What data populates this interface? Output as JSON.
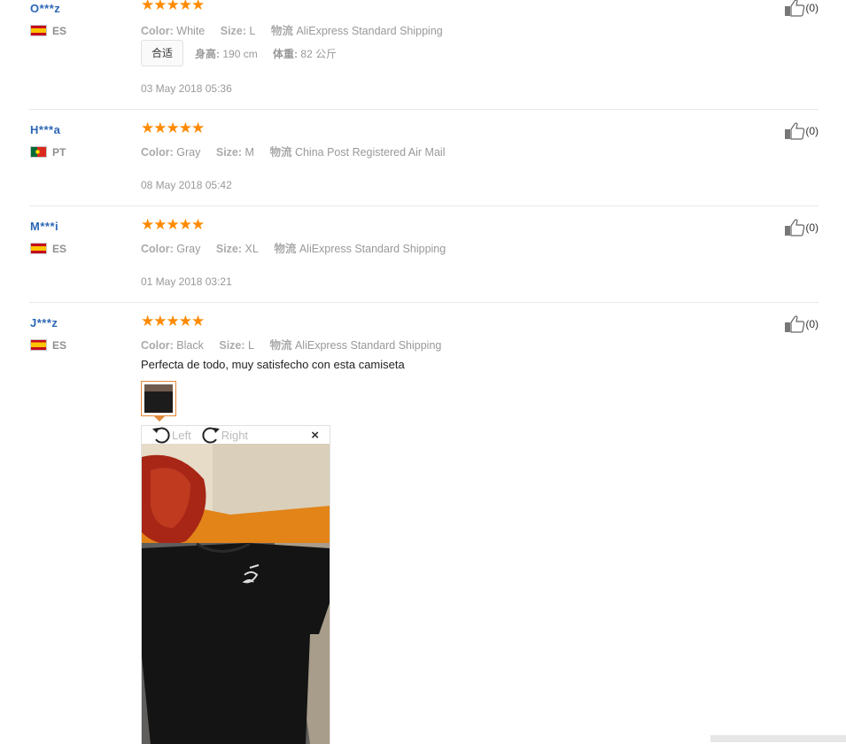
{
  "reviews": [
    {
      "user": "O***z",
      "country": "ES",
      "stars": "★★★★★",
      "rating": 5,
      "color_label": "Color:",
      "color_value": "White",
      "size_label": "Size:",
      "size_value": "L",
      "shipping_label": "物流",
      "shipping_value": "AliExpress Standard Shipping",
      "tag": "合适",
      "height_label": "身高:",
      "height_value": "190 cm",
      "weight_label": "体重:",
      "weight_value": "82 公斤",
      "date": "03 May 2018 05:36",
      "helpful_count": "(0)"
    },
    {
      "user": "H***a",
      "country": "PT",
      "stars": "★★★★★",
      "rating": 5,
      "color_label": "Color:",
      "color_value": "Gray",
      "size_label": "Size:",
      "size_value": "M",
      "shipping_label": "物流",
      "shipping_value": "China Post Registered Air Mail",
      "date": "08 May 2018 05:42",
      "helpful_count": "(0)"
    },
    {
      "user": "M***i",
      "country": "ES",
      "stars": "★★★★★",
      "rating": 5,
      "color_label": "Color:",
      "color_value": "Gray",
      "size_label": "Size:",
      "size_value": "XL",
      "shipping_label": "物流",
      "shipping_value": "AliExpress Standard Shipping",
      "date": "01 May 2018 03:21",
      "helpful_count": "(0)"
    },
    {
      "user": "J***z",
      "country": "ES",
      "stars": "★★★★★",
      "rating": 5,
      "color_label": "Color:",
      "color_value": "Black",
      "size_label": "Size:",
      "size_value": "L",
      "shipping_label": "物流",
      "shipping_value": "AliExpress Standard Shipping",
      "comment": "Perfecta de todo, muy satisfecho con esta camiseta",
      "helpful_count": "(0)"
    }
  ],
  "viewer": {
    "rotate_left_label": "Left",
    "rotate_right_label": "Right",
    "close_glyph": "×"
  },
  "icons": {
    "thumbs_up": "thumbs-up-icon",
    "rotate_left": "rotate-left-icon",
    "rotate_right": "rotate-right-icon",
    "close": "close-icon"
  },
  "colors": {
    "star": "#ff8a00",
    "username": "#2b66b5",
    "thumb_border": "#e08a3c"
  }
}
